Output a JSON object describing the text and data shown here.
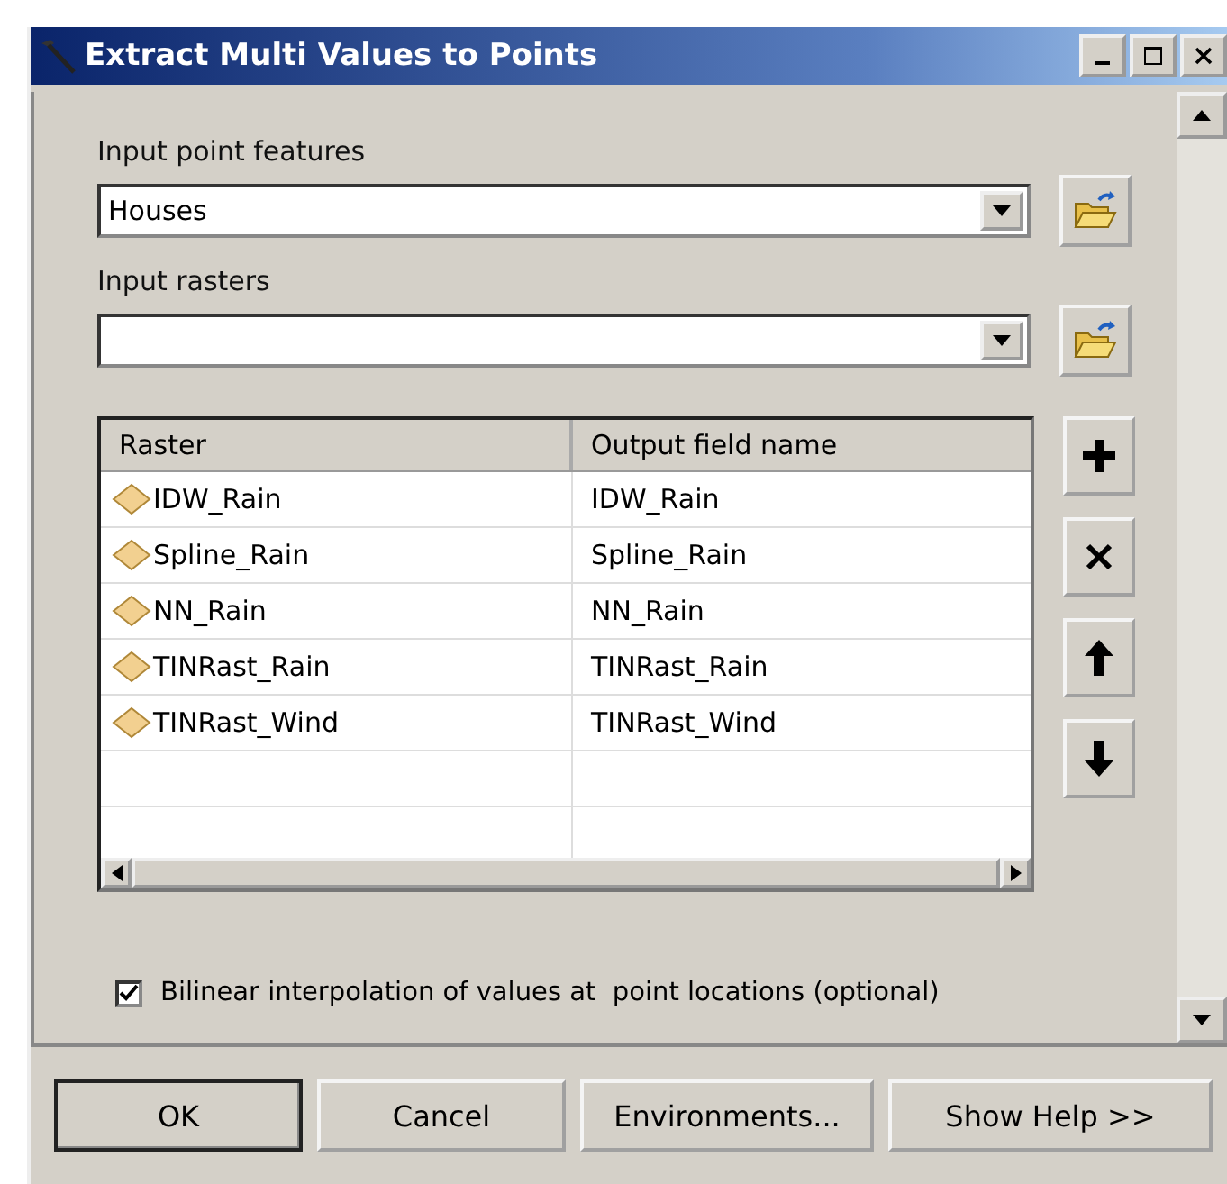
{
  "window": {
    "title": "Extract Multi Values to Points"
  },
  "input_point_features": {
    "label": "Input point features",
    "value": "Houses"
  },
  "input_rasters": {
    "label": "Input rasters"
  },
  "table": {
    "columns": [
      "Raster",
      "Output field name"
    ],
    "rows": [
      {
        "raster": "IDW_Rain",
        "output_field_name": "IDW_Rain"
      },
      {
        "raster": "Spline_Rain",
        "output_field_name": "Spline_Rain"
      },
      {
        "raster": "NN_Rain",
        "output_field_name": "NN_Rain"
      },
      {
        "raster": "TINRast_Rain",
        "output_field_name": "TINRast_Rain"
      },
      {
        "raster": "TINRast_Wind",
        "output_field_name": "TINRast_Wind"
      }
    ]
  },
  "bilinear_option": {
    "label": "Bilinear interpolation of values at  point locations (optional)",
    "checked": true
  },
  "buttons": [
    {
      "label": "OK",
      "default": true
    },
    {
      "label": "Cancel",
      "default": false
    },
    {
      "label": "Environments...",
      "default": false
    },
    {
      "label": "Show Help >>",
      "default": false
    }
  ]
}
